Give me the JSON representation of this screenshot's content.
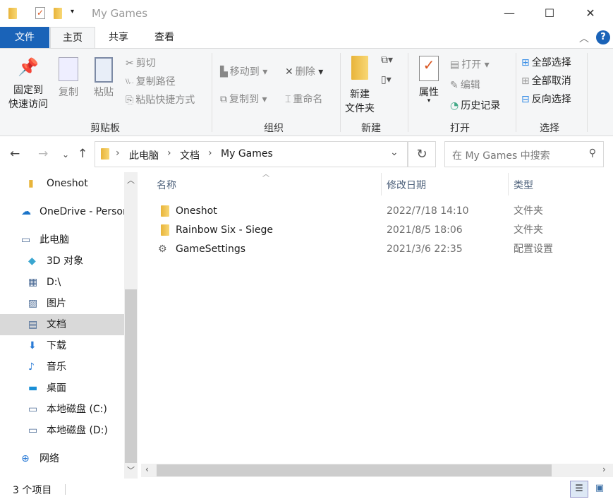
{
  "window": {
    "title": "My Games",
    "minimize": "—",
    "maximize": "☐",
    "close": "✕"
  },
  "tabs": {
    "file": "文件",
    "home": "主页",
    "share": "共享",
    "view": "查看"
  },
  "ribbon": {
    "clipboard": {
      "label": "剪贴板",
      "pin": [
        "固定到",
        "快速访问"
      ],
      "copy": "复制",
      "paste": "粘贴",
      "cut": "剪切",
      "copy_path": "复制路径",
      "paste_shortcut": "粘贴快捷方式"
    },
    "organize": {
      "label": "组织",
      "move_to": "移动到",
      "copy_to": "复制到",
      "delete": "删除",
      "rename": "重命名"
    },
    "new": {
      "label": "新建",
      "new_folder": [
        "新建",
        "文件夹"
      ]
    },
    "open": {
      "label": "打开",
      "properties": "属性",
      "open": "打开",
      "edit": "编辑",
      "history": "历史记录"
    },
    "select": {
      "label": "选择",
      "select_all": "全部选择",
      "select_none": "全部取消",
      "invert": "反向选择"
    }
  },
  "address": {
    "crumbs": [
      "此电脑",
      "文档",
      "My Games"
    ],
    "search_placeholder": "在 My Games 中搜索"
  },
  "sidebar": [
    {
      "label": "Oneshot",
      "icon": "folder-icon"
    },
    {
      "label": "OneDrive - Personal",
      "icon": "cloud-icon"
    },
    {
      "label": "此电脑",
      "icon": "computer-icon"
    },
    {
      "label": "3D 对象",
      "icon": "3d-objects-icon"
    },
    {
      "label": "D:\\",
      "icon": "video-icon"
    },
    {
      "label": "图片",
      "icon": "pictures-icon"
    },
    {
      "label": "文档",
      "icon": "documents-icon",
      "selected": true
    },
    {
      "label": "下载",
      "icon": "download-icon"
    },
    {
      "label": "音乐",
      "icon": "music-icon"
    },
    {
      "label": "桌面",
      "icon": "desktop-icon"
    },
    {
      "label": "本地磁盘 (C:)",
      "icon": "drive-icon"
    },
    {
      "label": "本地磁盘 (D:)",
      "icon": "drive-icon"
    },
    {
      "label": "网络",
      "icon": "network-icon"
    }
  ],
  "columns": {
    "name": "名称",
    "date": "修改日期",
    "type": "类型"
  },
  "files": [
    {
      "name": "Oneshot",
      "date": "2022/7/18 14:10",
      "type": "文件夹"
    },
    {
      "name": "Rainbow Six - Siege",
      "date": "2021/8/5 18:06",
      "type": "文件夹"
    },
    {
      "name": "GameSettings",
      "date": "2021/3/6 22:35",
      "type": "配置设置"
    }
  ],
  "status": {
    "count": "3 个项目"
  }
}
